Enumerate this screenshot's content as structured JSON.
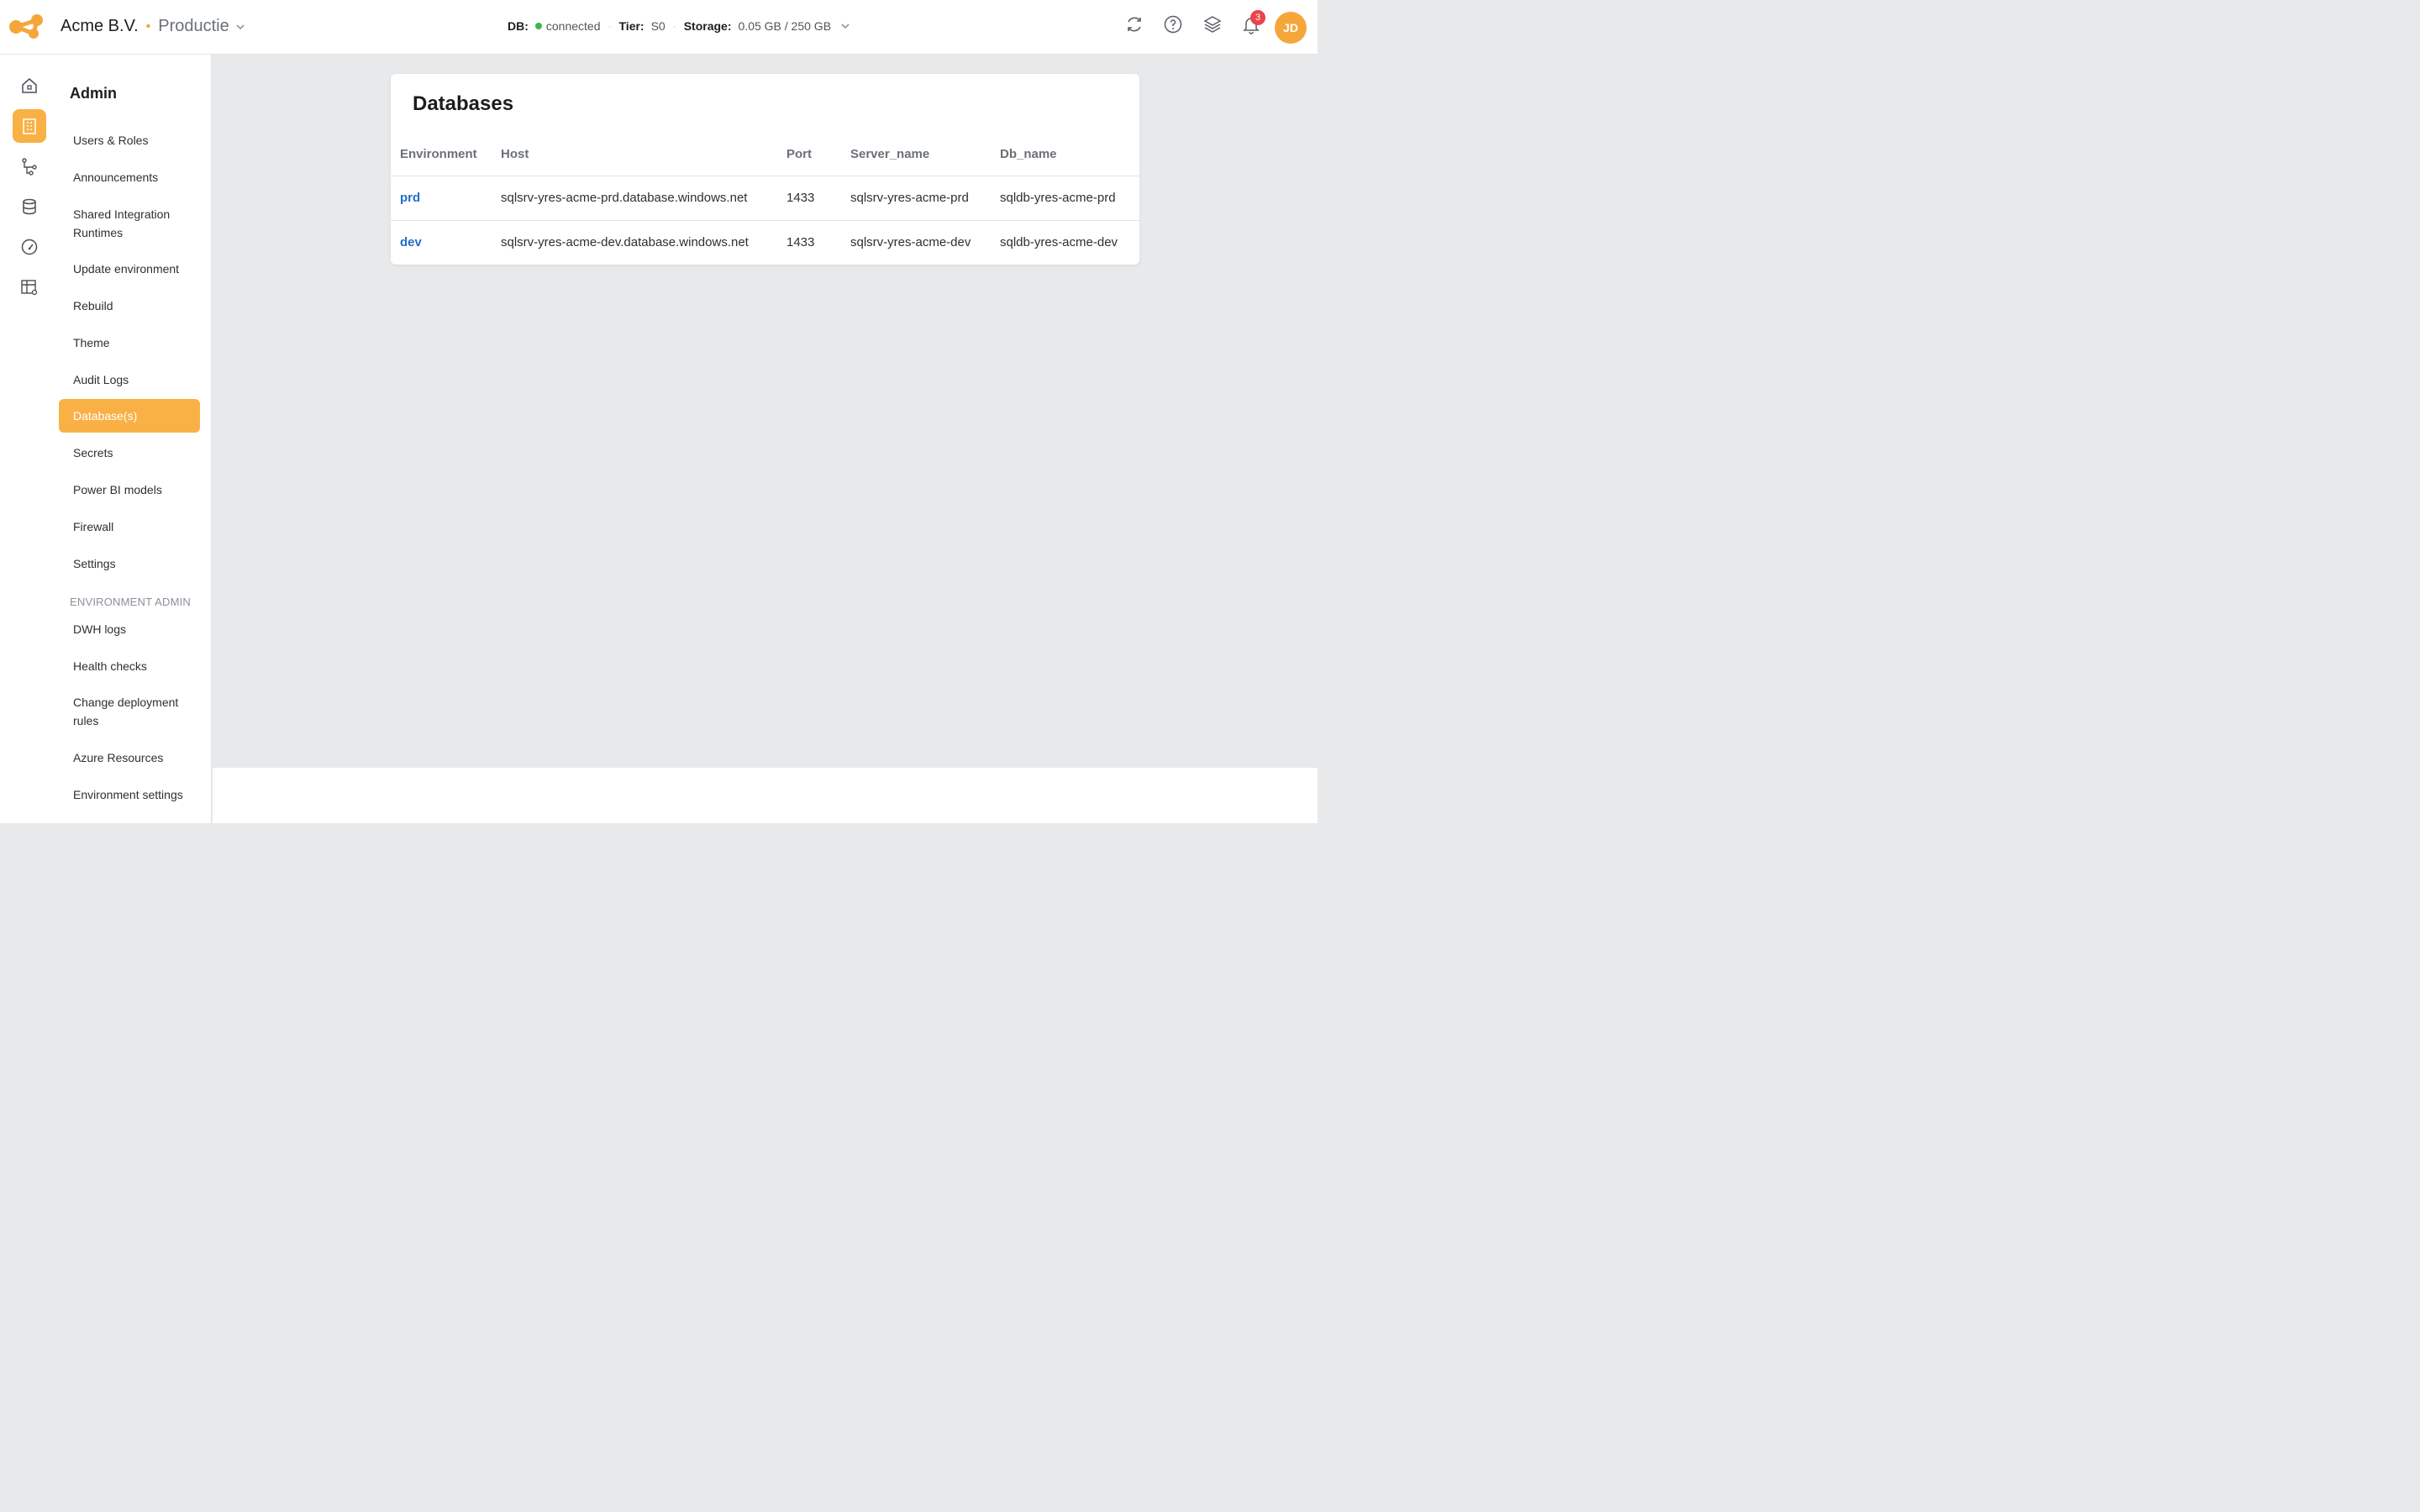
{
  "header": {
    "org_name": "Acme B.V.",
    "environment": "Productie",
    "db_label": "DB:",
    "db_status": "connected",
    "tier_label": "Tier:",
    "tier_value": "S0",
    "storage_label": "Storage:",
    "storage_value": "0.05 GB / 250 GB",
    "notification_count": "3",
    "avatar_initials": "JD",
    "colors": {
      "accent": "#f9b145",
      "connected": "#3cb64f",
      "badge": "#e8454a",
      "link": "#1f6fc6"
    }
  },
  "rail": {
    "icons": [
      "home-icon",
      "building-icon",
      "pipeline-icon",
      "database-icon",
      "gauge-icon",
      "table-settings-icon"
    ],
    "active": "building-icon"
  },
  "nav": {
    "title": "Admin",
    "items": [
      "Users & Roles",
      "Announcements",
      "Shared Integration Runtimes",
      "Update environment",
      "Rebuild",
      "Theme",
      "Audit Logs",
      "Database(s)",
      "Secrets",
      "Power BI models",
      "Firewall",
      "Settings"
    ],
    "active_item": "Database(s)",
    "section_label": "ENVIRONMENT ADMIN",
    "section_items": [
      "DWH logs",
      "Health checks",
      "Change deployment rules",
      "Azure Resources",
      "Environment settings"
    ]
  },
  "main": {
    "title": "Databases",
    "columns": [
      "Environment",
      "Host",
      "Port",
      "Server_name",
      "Db_name"
    ],
    "rows": [
      [
        "prd",
        "sqlsrv-yres-acme-prd.database.windows.net",
        "1433",
        "sqlsrv-yres-acme-prd",
        "sqldb-yres-acme-prd"
      ],
      [
        "dev",
        "sqlsrv-yres-acme-dev.database.windows.net",
        "1433",
        "sqlsrv-yres-acme-dev",
        "sqldb-yres-acme-dev"
      ]
    ]
  }
}
